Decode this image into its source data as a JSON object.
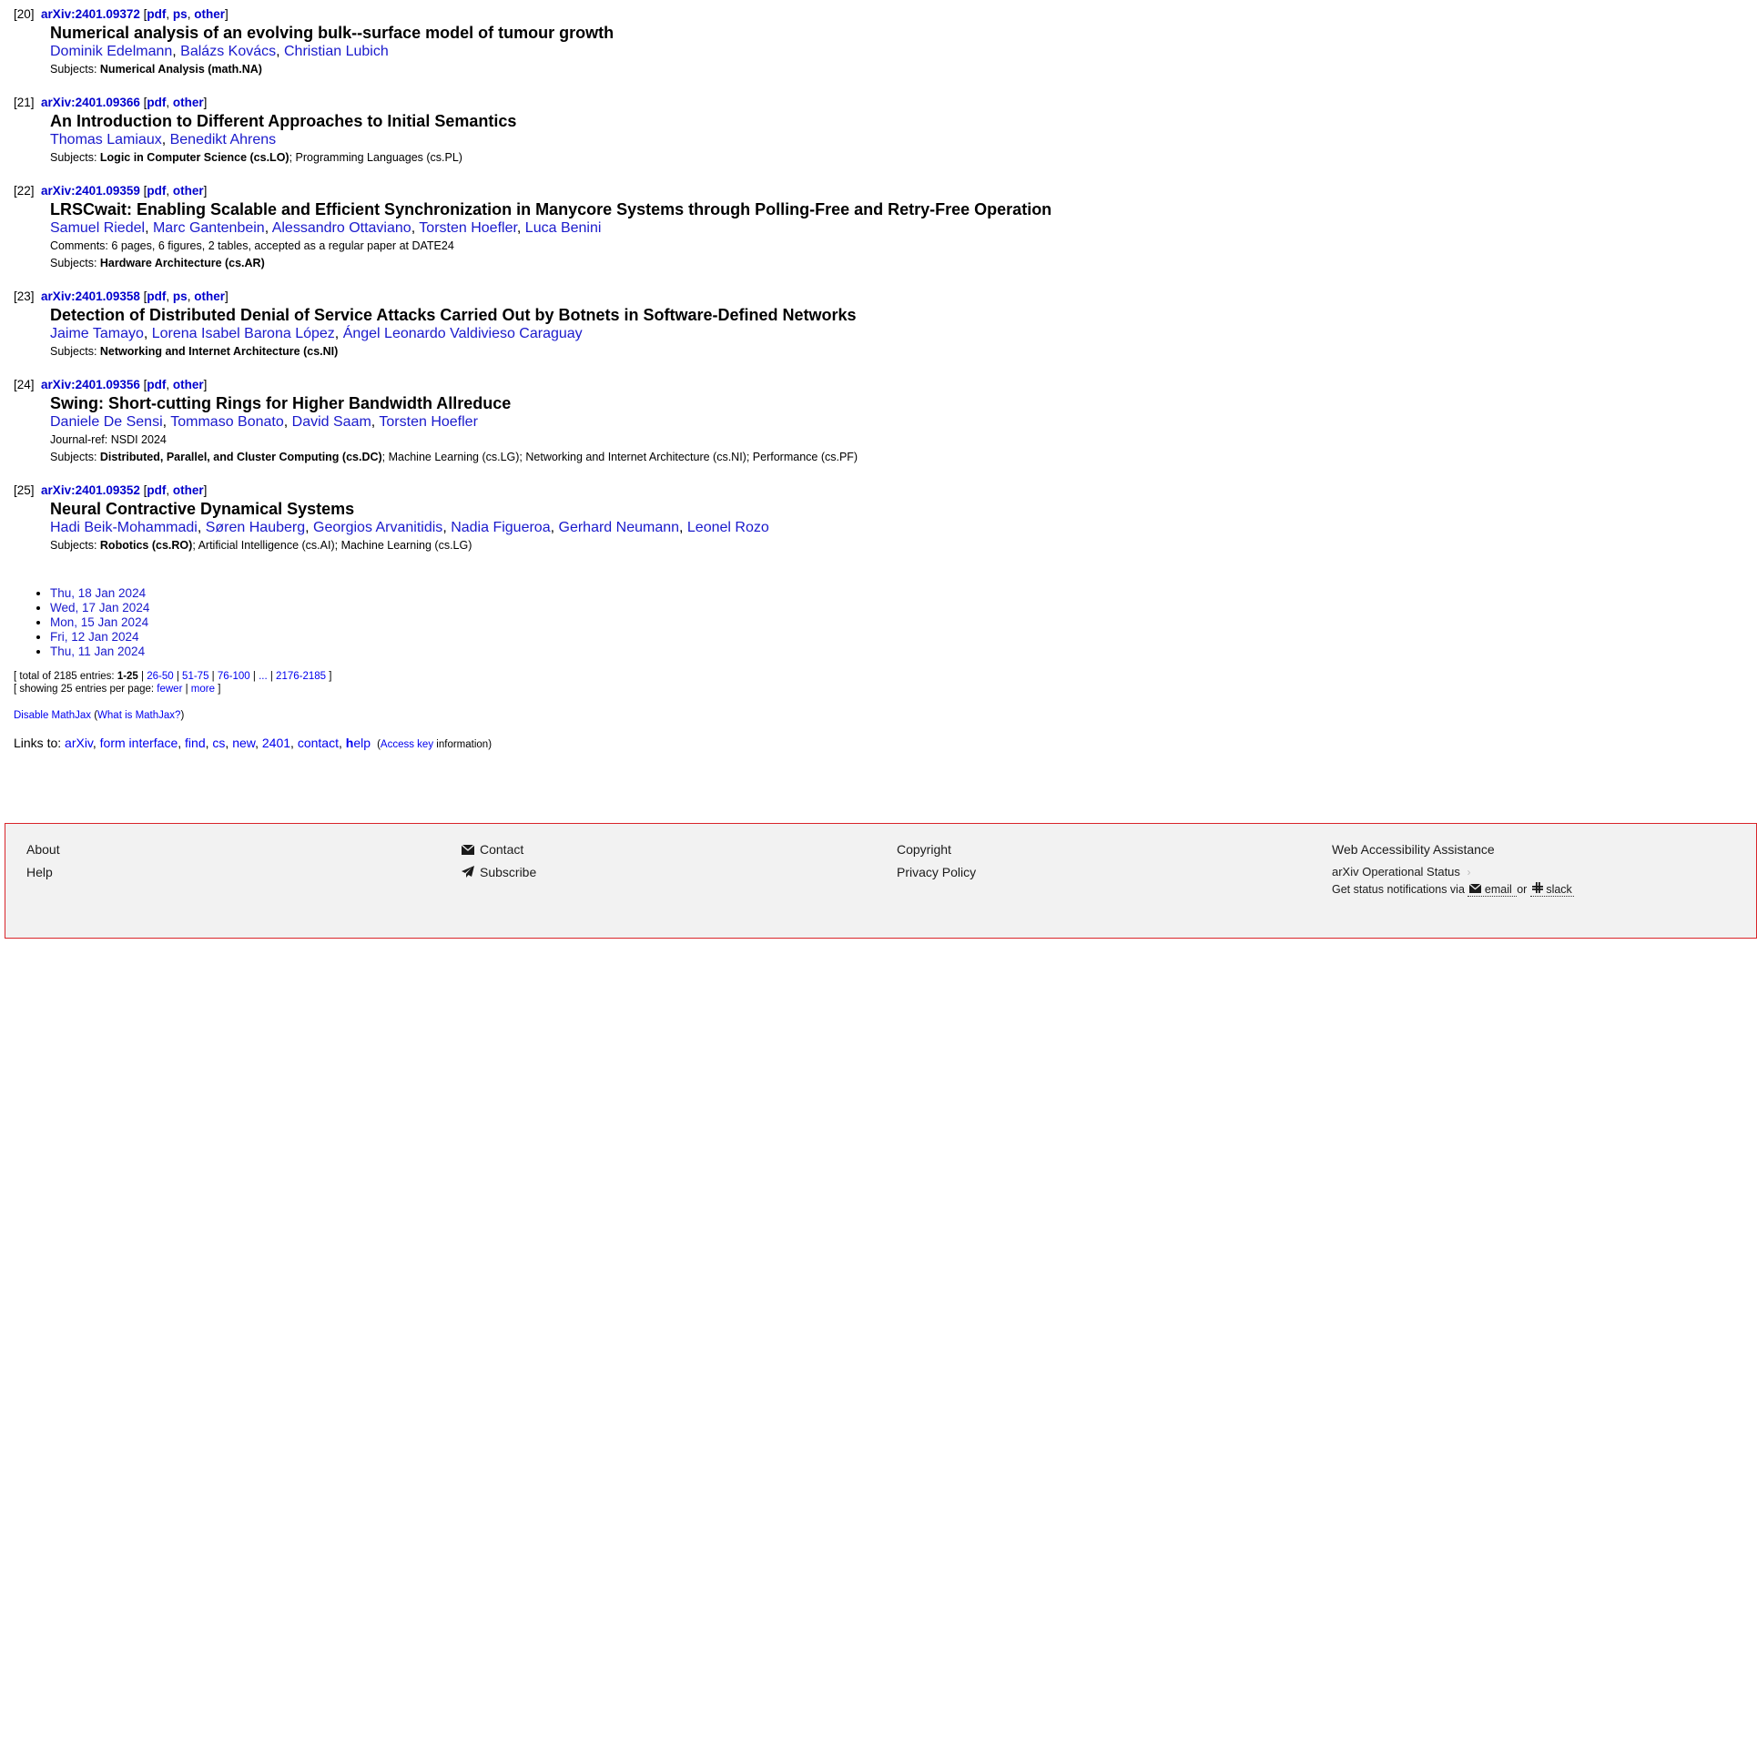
{
  "entries": [
    {
      "index": "[20]",
      "id": "arXiv:2401.09372",
      "formats": [
        "pdf",
        "ps",
        "other"
      ],
      "title": "Numerical analysis of an evolving bulk--surface model of tumour growth",
      "authors": [
        "Dominik Edelmann",
        "Balázs Kovács",
        "Christian Lubich"
      ],
      "comments": "",
      "journal_ref": "",
      "primary_subject": "Numerical Analysis (math.NA)",
      "other_subjects": ""
    },
    {
      "index": "[21]",
      "id": "arXiv:2401.09366",
      "formats": [
        "pdf",
        "other"
      ],
      "title": "An Introduction to Different Approaches to Initial Semantics",
      "authors": [
        "Thomas Lamiaux",
        "Benedikt Ahrens"
      ],
      "comments": "",
      "journal_ref": "",
      "primary_subject": "Logic in Computer Science (cs.LO)",
      "other_subjects": "; Programming Languages (cs.PL)"
    },
    {
      "index": "[22]",
      "id": "arXiv:2401.09359",
      "formats": [
        "pdf",
        "other"
      ],
      "title": "LRSCwait: Enabling Scalable and Efficient Synchronization in Manycore Systems through Polling-Free and Retry-Free Operation",
      "authors": [
        "Samuel Riedel",
        "Marc Gantenbein",
        "Alessandro Ottaviano",
        "Torsten Hoefler",
        "Luca Benini"
      ],
      "comments": "6 pages, 6 figures, 2 tables, accepted as a regular paper at DATE24",
      "journal_ref": "",
      "primary_subject": "Hardware Architecture (cs.AR)",
      "other_subjects": ""
    },
    {
      "index": "[23]",
      "id": "arXiv:2401.09358",
      "formats": [
        "pdf",
        "ps",
        "other"
      ],
      "title": "Detection of Distributed Denial of Service Attacks Carried Out by Botnets in Software-Defined Networks",
      "authors": [
        "Jaime Tamayo",
        "Lorena Isabel Barona López",
        "Ángel Leonardo Valdivieso Caraguay"
      ],
      "comments": "",
      "journal_ref": "",
      "primary_subject": "Networking and Internet Architecture (cs.NI)",
      "other_subjects": ""
    },
    {
      "index": "[24]",
      "id": "arXiv:2401.09356",
      "formats": [
        "pdf",
        "other"
      ],
      "title": "Swing: Short-cutting Rings for Higher Bandwidth Allreduce",
      "authors": [
        "Daniele De Sensi",
        "Tommaso Bonato",
        "David Saam",
        "Torsten Hoefler"
      ],
      "comments": "",
      "journal_ref": "NSDI 2024",
      "primary_subject": "Distributed, Parallel, and Cluster Computing (cs.DC)",
      "other_subjects": "; Machine Learning (cs.LG); Networking and Internet Architecture (cs.NI); Performance (cs.PF)"
    },
    {
      "index": "[25]",
      "id": "arXiv:2401.09352",
      "formats": [
        "pdf",
        "other"
      ],
      "title": "Neural Contractive Dynamical Systems",
      "authors": [
        "Hadi Beik-Mohammadi",
        "Søren Hauberg",
        "Georgios Arvanitidis",
        "Nadia Figueroa",
        "Gerhard Neumann",
        "Leonel Rozo"
      ],
      "comments": "",
      "journal_ref": "",
      "primary_subject": "Robotics (cs.RO)",
      "other_subjects": "; Artificial Intelligence (cs.AI); Machine Learning (cs.LG)"
    }
  ],
  "labels": {
    "subjects": "Subjects:",
    "comments": "Comments:",
    "journal_ref": "Journal-ref:"
  },
  "dates": [
    "Thu, 18 Jan 2024",
    "Wed, 17 Jan 2024",
    "Mon, 15 Jan 2024",
    "Fri, 12 Jan 2024",
    "Thu, 11 Jan 2024"
  ],
  "paging": {
    "total_prefix": "[ total of 2185 entries:",
    "current": "1-25",
    "pages": [
      "26-50",
      "51-75",
      "76-100",
      "...",
      "2176-2185"
    ],
    "total_suffix": "]",
    "showing_prefix": "[ showing 25 entries per page:",
    "fewer": "fewer",
    "more": "more",
    "showing_suffix": "]"
  },
  "mathjax": {
    "disable": "Disable MathJax",
    "what_is": "What is MathJax?"
  },
  "links_line": {
    "prefix": "Links to:",
    "links": [
      "arXiv",
      "form interface",
      "find",
      "cs",
      "new",
      "2401",
      "contact"
    ],
    "help": "help",
    "access_key": "Access key",
    "information": "information"
  },
  "footer": {
    "col1": [
      "About",
      "Help"
    ],
    "contact": "Contact",
    "subscribe": "Subscribe",
    "col3": [
      "Copyright",
      "Privacy Policy"
    ],
    "accessibility": "Web Accessibility Assistance",
    "status": "arXiv Operational Status",
    "notify_prefix": "Get status notifications via",
    "email": "email",
    "or": "or",
    "slack": "slack"
  },
  "colors": {
    "link": "#0000ee",
    "footer_bg": "#f2f2f2",
    "footer_border": "#d9252a"
  },
  "icons": {
    "contact": "envelope-icon",
    "subscribe": "paper-plane-icon",
    "status": "chevron-right-icon",
    "email": "envelope-icon",
    "slack": "slack-icon"
  }
}
